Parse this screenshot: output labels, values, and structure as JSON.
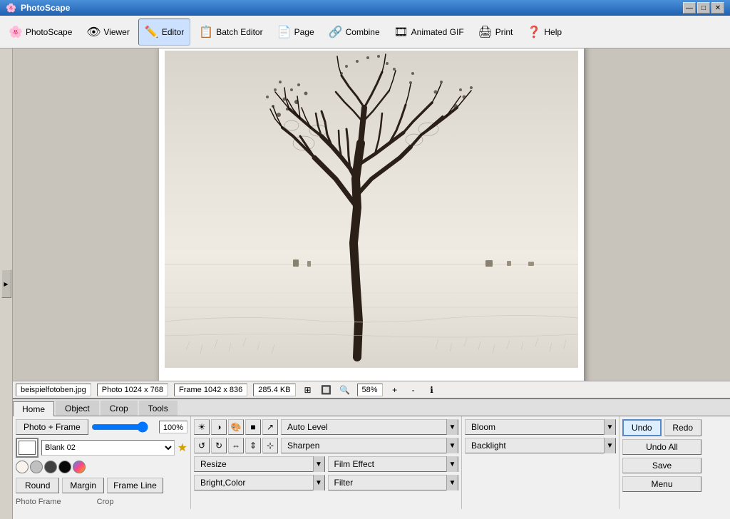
{
  "app": {
    "title": "PhotoScape",
    "icon": "🌸"
  },
  "titlebar": {
    "minimize": "—",
    "maximize": "□",
    "close": "✕"
  },
  "menu": {
    "items": [
      {
        "id": "photoscape",
        "label": "PhotoScape",
        "icon": "🌸"
      },
      {
        "id": "viewer",
        "label": "Viewer",
        "icon": "👁"
      },
      {
        "id": "editor",
        "label": "Editor",
        "icon": "✏️",
        "active": true
      },
      {
        "id": "batch",
        "label": "Batch Editor",
        "icon": "📋"
      },
      {
        "id": "page",
        "label": "Page",
        "icon": "📄"
      },
      {
        "id": "combine",
        "label": "Combine",
        "icon": "🔗"
      },
      {
        "id": "gif",
        "label": "Animated GIF",
        "icon": "🎞"
      },
      {
        "id": "print",
        "label": "Print",
        "icon": "🖨"
      },
      {
        "id": "help",
        "label": "Help",
        "icon": "❓"
      }
    ]
  },
  "statusbar": {
    "filename": "beispielfotoben.jpg",
    "photo_size": "Photo 1024 x 768",
    "frame_size": "Frame 1042 x 836",
    "file_size": "285.4 KB",
    "zoom": "58%"
  },
  "tabs": [
    {
      "id": "home",
      "label": "Home",
      "active": true
    },
    {
      "id": "object",
      "label": "Object"
    },
    {
      "id": "crop",
      "label": "Crop"
    },
    {
      "id": "tools",
      "label": "Tools"
    }
  ],
  "toolbar": {
    "photo_frame_label": "Photo + Frame",
    "slider_value": "100%",
    "preset_label": "Blank 02",
    "round_label": "Round",
    "margin_label": "Margin",
    "frame_line_label": "Frame Line",
    "auto_level_label": "Auto Level",
    "sharpen_label": "Sharpen",
    "film_effect_label": "Film Effect",
    "bright_color_label": "Bright,Color",
    "filter_label": "Filter",
    "bloom_label": "Bloom",
    "backlight_label": "Backlight",
    "undo_label": "Undo",
    "redo_label": "Redo",
    "undo_all_label": "Undo All",
    "save_label": "Save",
    "menu_label": "Menu",
    "photo_frame_section": "Photo Frame",
    "crop_section": "Crop"
  },
  "colors": {
    "accent": "#2060b0",
    "background": "#d4d0c8",
    "panel": "#f0f0f0"
  }
}
